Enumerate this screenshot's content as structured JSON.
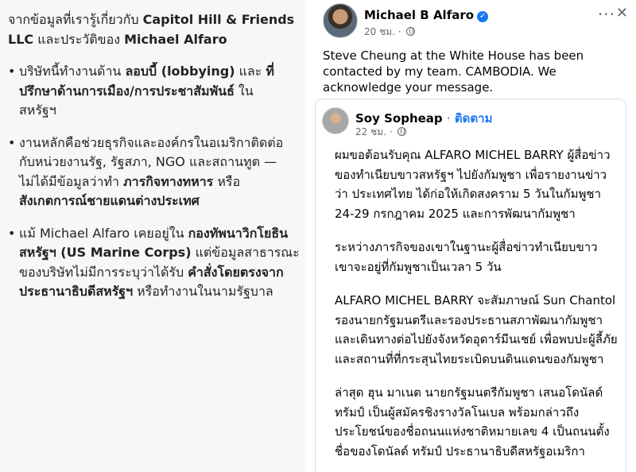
{
  "left": {
    "intro": {
      "pre": "จากข้อมูลที่เรารู้เกี่ยวกับ ",
      "company": "Capitol Hill & Friends LLC",
      "mid": " และประวัติของ ",
      "person": "Michael Alfaro"
    },
    "bullets": [
      {
        "lines": [
          [
            {
              "t": "บริษัทนี้ทำงานด้าน "
            },
            {
              "t": "ลอบบี้ (lobbying)",
              "b": true
            },
            {
              "t": " และ "
            },
            {
              "t": "ที่",
              "b": true
            }
          ],
          [
            {
              "t": "ปรึกษาด้านการเมือง/การประชาสัมพันธ์",
              "b": true
            },
            {
              "t": " ใน"
            }
          ],
          [
            {
              "t": "สหรัฐฯ"
            }
          ]
        ]
      },
      {
        "lines": [
          [
            {
              "t": "งานหลักคือช่วยธุรกิจและองค์กรในอเมริกาติดต่อ"
            }
          ],
          [
            {
              "t": "กับหน่วยงานรัฐ, รัฐสภา, NGO และสถานทูต —"
            }
          ],
          [
            {
              "t": "ไม่ได้มีข้อมูลว่าทำ "
            },
            {
              "t": "ภารกิจทางทหาร",
              "b": true
            },
            {
              "t": " หรือ"
            }
          ],
          [
            {
              "t": "สังเกตการณ์ชายแดนต่างประเทศ",
              "b": true
            }
          ]
        ]
      },
      {
        "lines": [
          [
            {
              "t": "แม้ Michael Alfaro เคยอยู่ใน "
            },
            {
              "t": "กองทัพนาวิกโยธิน",
              "b": true
            }
          ],
          [
            {
              "t": "สหรัฐฯ (US Marine Corps)",
              "b": true
            },
            {
              "t": " แต่ข้อมูลสาธารณะ"
            }
          ],
          [
            {
              "t": "ของบริษัทไม่มีการระบุว่าได้รับ "
            },
            {
              "t": "คำสั่งโดยตรงจาก",
              "b": true
            }
          ],
          [
            {
              "t": "ประธานาธิบดีสหรัฐฯ",
              "b": true
            },
            {
              "t": " หรือทำงานในนามรัฐบาล"
            }
          ]
        ]
      }
    ]
  },
  "post": {
    "author": "Michael B Alfaro",
    "time": "20 ชม. ·",
    "text": "Steve Cheung at the White House has been contacted by my team. CAMBODIA. We acknowledge your message.",
    "more": "···",
    "close": "✕",
    "shared": {
      "author": "Soy Sopheap",
      "follow": "ติดตาม",
      "time": "22 ชม. ·",
      "paragraphs": [
        "ผมขอต้อนรับคุณ ALFARO MICHEL BARRY ผู้สื่อข่าวของทำเนียบขาวสหรัฐฯ ไปยังกัมพูชา เพื่อรายงานข่าวว่า ประเทศไทย ได้ก่อให้เกิดสงคราม 5 วันในกัมพูชา 24-29 กรกฎาคม 2025 และการพัฒนากัมพูชา",
        "ระหว่างภารกิจของเขาในฐานะผู้สื่อข่าวทำเนียบขาว เขาจะอยู่ที่กัมพูชาเป็นเวลา 5 วัน",
        "ALFARO MICHEL BARRY จะสัมภาษณ์ Sun Chantol รองนายกรัฐมนตรีและรองประธานสภาพัฒนากัมพูชา และเดินทางต่อไปยังจังหวัดอุดาร์มีนเชย์ เพื่อพบปะผู้ลี้ภัยและสถานที่ที่กระสุนไทยระเบิดบนดินแดนของกัมพูชา",
        "ล่าสุด ฮุน มาเนต นายกรัฐมนตรีกัมพูชา เสนอโดนัลด์ ทรัมป์ เป็นผู้สมัครชิงรางวัลโนเบล พร้อมกล่าวถึงประโยชน์ของชื่อถนนแห่งชาติหมายเลข 4 เป็นถนนตั้งชื่อของโดนัลด์ ทรัมป์ ประธานาธิบดีสหรัฐอเมริกา"
      ]
    }
  }
}
